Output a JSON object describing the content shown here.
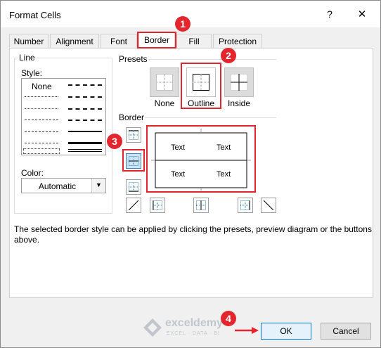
{
  "window": {
    "title": "Format Cells",
    "help": "?",
    "close": "✕"
  },
  "tabs": [
    {
      "label": "Number"
    },
    {
      "label": "Alignment"
    },
    {
      "label": "Font"
    },
    {
      "label": "Border",
      "active": true
    },
    {
      "label": "Fill"
    },
    {
      "label": "Protection"
    }
  ],
  "line": {
    "group_label": "Line",
    "style_label": "Style:",
    "style_none": "None",
    "color_label": "Color:",
    "color_value": "Automatic"
  },
  "presets": {
    "label": "Presets",
    "items": [
      {
        "label": "None"
      },
      {
        "label": "Outline"
      },
      {
        "label": "Inside"
      }
    ]
  },
  "border": {
    "label": "Border",
    "preview_text": [
      "Text",
      "Text",
      "Text",
      "Text"
    ]
  },
  "info": "The selected border style can be applied by clicking the presets, preview diagram or the buttons above.",
  "buttons": {
    "ok": "OK",
    "cancel": "Cancel"
  },
  "callouts": [
    "1",
    "2",
    "3",
    "4"
  ],
  "watermark": {
    "name": "exceldemy",
    "tagline": "EXCEL · DATA · BI"
  },
  "colors": {
    "callout": "#e3252d",
    "selected_button": "#cce4f7",
    "accent": "#0078d7"
  }
}
